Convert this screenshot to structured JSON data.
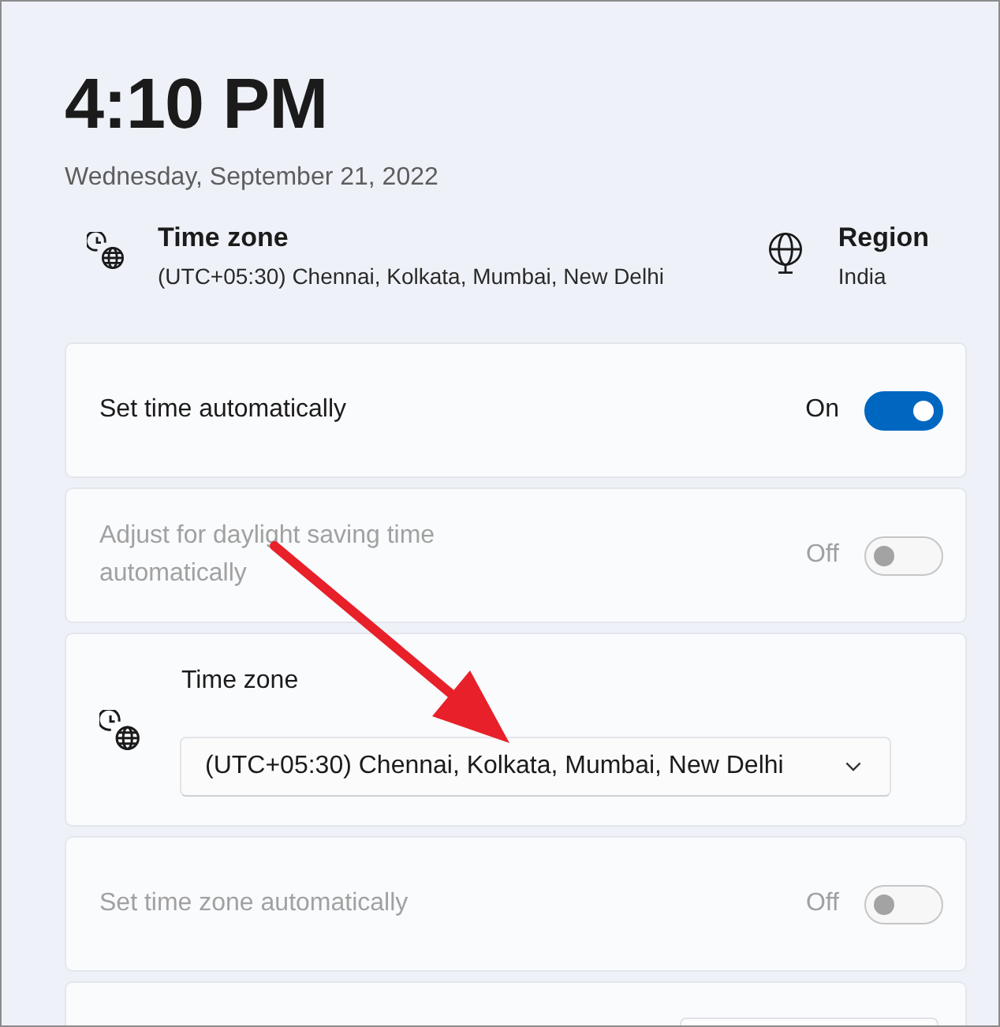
{
  "clock": {
    "time": "4:10 PM",
    "date": "Wednesday, September 21, 2022"
  },
  "summary": [
    {
      "kind": "timezone",
      "title": "Time zone",
      "value": "(UTC+05:30) Chennai, Kolkata, Mumbai, New Delhi"
    },
    {
      "kind": "region",
      "title": "Region",
      "value": "India"
    }
  ],
  "settings": [
    {
      "kind": "toggle",
      "label": "Set time automatically",
      "state_label": "On",
      "on": true,
      "disabled": false
    },
    {
      "kind": "toggle",
      "label": "Adjust for daylight saving time automatically",
      "state_label": "Off",
      "on": false,
      "disabled": true
    },
    {
      "kind": "dropdown",
      "label": "Time zone",
      "value": "(UTC+05:30) Chennai, Kolkata, Mumbai, New Delhi"
    },
    {
      "kind": "toggle",
      "label": "Set time zone automatically",
      "state_label": "Off",
      "on": false,
      "disabled": true
    },
    {
      "kind": "partial"
    }
  ]
}
